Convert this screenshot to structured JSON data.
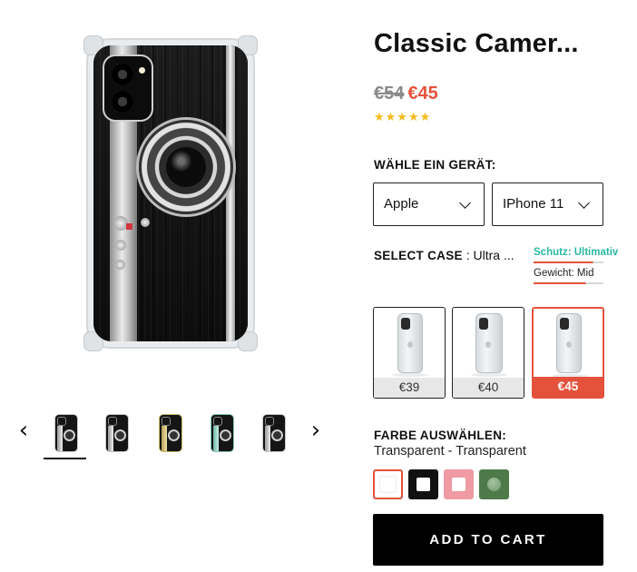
{
  "product": {
    "title": "Classic Camer...",
    "price_old": "€54",
    "price_new": "€45",
    "stars": "★★★★★",
    "rating_stars": 5
  },
  "device": {
    "label": "WÄHLE EIN GERÄT:",
    "brand_value": "Apple",
    "model_value": "IPhone 11"
  },
  "case": {
    "label": "SELECT CASE",
    "separator": " : ",
    "value": "Ultra ...",
    "protection_label": "Schutz: Ultimativ",
    "weight_label": "Gewicht: Mid",
    "options": [
      {
        "price": "€39"
      },
      {
        "price": "€40"
      },
      {
        "price": "€45",
        "selected": true
      }
    ]
  },
  "color": {
    "label": "FARBE AUSWÄHLEN:",
    "selected_name": "Transparent - Transparent",
    "swatches": [
      {
        "name": "transparent",
        "hex": "#ffffff",
        "selected": true
      },
      {
        "name": "black",
        "hex": "#111111"
      },
      {
        "name": "pink",
        "hex": "#f09aa3"
      },
      {
        "name": "green",
        "hex": "#4e7a4a"
      }
    ]
  },
  "gallery": {
    "prev_icon": "‹",
    "next_icon": "›",
    "thumbnail_count": 5,
    "active_index": 0
  },
  "cart": {
    "button_label": "ADD TO CART"
  },
  "colors": {
    "accent": "#e4523b",
    "protection": "#2ab8a1",
    "stars": "#f5b91d"
  }
}
